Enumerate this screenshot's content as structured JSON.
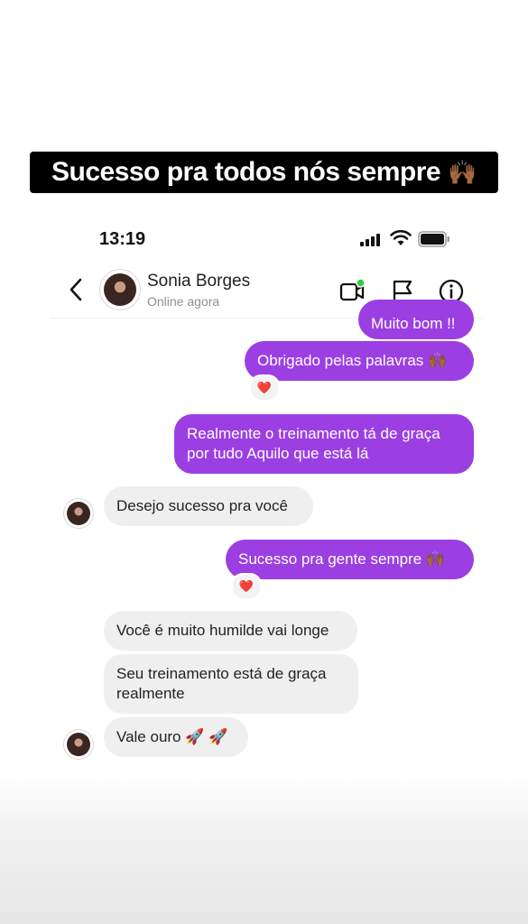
{
  "caption": {
    "text": "Sucesso pra todos nós sempre",
    "emoji": "🙌🏾"
  },
  "status_bar": {
    "time": "13:19"
  },
  "header": {
    "name": "Sonia Borges",
    "status": "Online agora"
  },
  "icons": {
    "back": "chevron-left-icon",
    "video": "video-call-icon",
    "flag": "flag-icon",
    "info": "info-icon",
    "reaction": "heart-reaction-icon"
  },
  "colors": {
    "outgoing_bubble": "#9b3fe3",
    "incoming_bubble": "#efefef",
    "online_dot": "#2ecc40"
  },
  "messages": [
    {
      "from": "me",
      "text": "Muito bom !!"
    },
    {
      "from": "me",
      "text": "Obrigado pelas palavras 🙌🏾",
      "reaction": "❤️"
    },
    {
      "from": "me",
      "text": "Realmente o treinamento tá de graça por tudo Aquilo que está lá"
    },
    {
      "from": "contact",
      "text": "Desejo sucesso pra você"
    },
    {
      "from": "me",
      "text": "Sucesso pra gente sempre 🙌🏾",
      "reaction": "❤️"
    },
    {
      "from": "contact",
      "text": "Você é muito humilde vai longe"
    },
    {
      "from": "contact",
      "text": "Seu treinamento está de graça realmente"
    },
    {
      "from": "contact",
      "text": "Vale ouro 🚀 🚀"
    }
  ]
}
